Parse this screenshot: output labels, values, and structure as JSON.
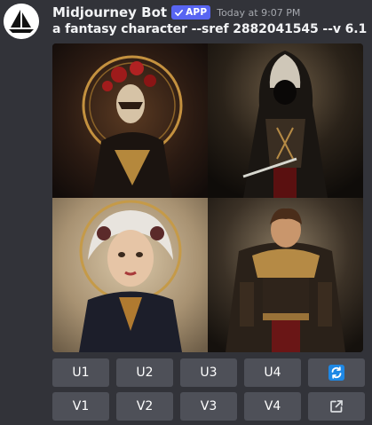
{
  "message": {
    "author": "Midjourney Bot",
    "app_badge": "APP",
    "timestamp": "Today at 9:07 PM",
    "prompt": "a fantasy character --sref 2882041545 --v 6.1",
    "avatar_icon": "midjourney-boat-icon",
    "badge_icon": "checkmark-icon"
  },
  "image_grid": {
    "tiles": [
      {
        "subject": "masked character with red roses and golden halo"
      },
      {
        "subject": "hooded assassin holding a dagger"
      },
      {
        "subject": "silver-haired woman in ornate dark dress"
      },
      {
        "subject": "armored warrior with cape"
      }
    ]
  },
  "buttons": {
    "row1": [
      {
        "label": "U1"
      },
      {
        "label": "U2"
      },
      {
        "label": "U3"
      },
      {
        "label": "U4"
      },
      {
        "icon": "reroll-icon",
        "color": "#1e88e5"
      }
    ],
    "row2": [
      {
        "label": "V1"
      },
      {
        "label": "V2"
      },
      {
        "label": "V3"
      },
      {
        "label": "V4"
      },
      {
        "icon": "open-external-icon"
      }
    ]
  },
  "colors": {
    "background": "#323339",
    "button": "#4e5058",
    "app_badge": "#5865f2"
  }
}
